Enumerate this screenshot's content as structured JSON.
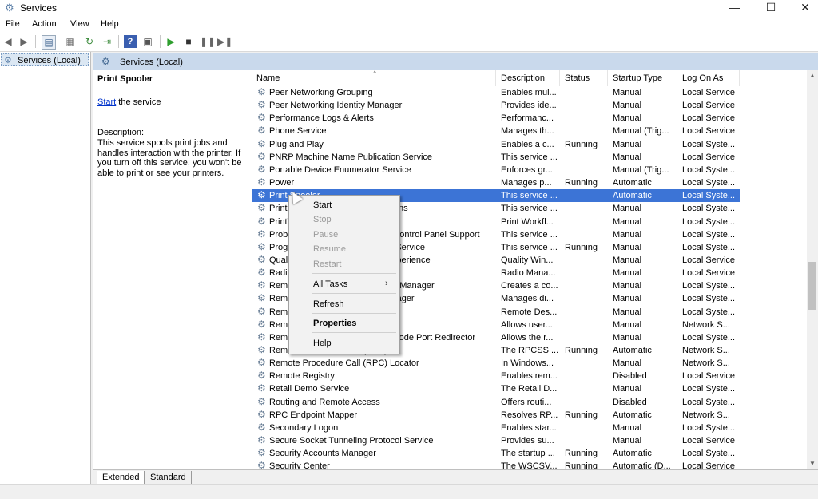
{
  "window": {
    "title": "Services",
    "minimize": "—",
    "maximize": "☐",
    "close": "✕"
  },
  "menu": [
    "File",
    "Action",
    "View",
    "Help"
  ],
  "tree": {
    "root": "Services (Local)"
  },
  "panel": {
    "header": "Services (Local)"
  },
  "details": {
    "service_name": "Print Spooler",
    "start_link": "Start",
    "start_suffix": " the service",
    "description_label": "Description:",
    "description": "This service spools print jobs and handles interaction with the printer. If you turn off this service, you won't be able to print or see your printers."
  },
  "columns": [
    "Name",
    "Description",
    "Status",
    "Startup Type",
    "Log On As"
  ],
  "rows": [
    {
      "name": "Peer Networking Grouping",
      "desc": "Enables mul...",
      "status": "",
      "startup": "Manual",
      "logon": "Local Service"
    },
    {
      "name": "Peer Networking Identity Manager",
      "desc": "Provides ide...",
      "status": "",
      "startup": "Manual",
      "logon": "Local Service"
    },
    {
      "name": "Performance Logs & Alerts",
      "desc": "Performanc...",
      "status": "",
      "startup": "Manual",
      "logon": "Local Service"
    },
    {
      "name": "Phone Service",
      "desc": "Manages th...",
      "status": "",
      "startup": "Manual (Trig...",
      "logon": "Local Service"
    },
    {
      "name": "Plug and Play",
      "desc": "Enables a c...",
      "status": "Running",
      "startup": "Manual",
      "logon": "Local Syste..."
    },
    {
      "name": "PNRP Machine Name Publication Service",
      "desc": "This service ...",
      "status": "",
      "startup": "Manual",
      "logon": "Local Service"
    },
    {
      "name": "Portable Device Enumerator Service",
      "desc": "Enforces gr...",
      "status": "",
      "startup": "Manual (Trig...",
      "logon": "Local Syste..."
    },
    {
      "name": "Power",
      "desc": "Manages p...",
      "status": "Running",
      "startup": "Automatic",
      "logon": "Local Syste..."
    },
    {
      "name": "Print Spooler",
      "desc": "This service ...",
      "status": "",
      "startup": "Automatic",
      "logon": "Local Syste..."
    },
    {
      "name": "Printer Extensions and Notifications",
      "desc": "This service ...",
      "status": "",
      "startup": "Manual",
      "logon": "Local Syste..."
    },
    {
      "name": "PrintWorkflow",
      "desc": "Print Workfl...",
      "status": "",
      "startup": "Manual",
      "logon": "Local Syste..."
    },
    {
      "name": "Problem Reports and Solutions Control Panel Support",
      "desc": "This service ...",
      "status": "",
      "startup": "Manual",
      "logon": "Local Syste..."
    },
    {
      "name": "Program Compatibility Assistant Service",
      "desc": "This service ...",
      "status": "Running",
      "startup": "Manual",
      "logon": "Local Syste..."
    },
    {
      "name": "Quality Windows Audio Video Experience",
      "desc": "Quality Win...",
      "status": "",
      "startup": "Manual",
      "logon": "Local Service"
    },
    {
      "name": "Radio Management Service",
      "desc": "Radio Mana...",
      "status": "",
      "startup": "Manual",
      "logon": "Local Service"
    },
    {
      "name": "Remote Access Auto Connection Manager",
      "desc": "Creates a co...",
      "status": "",
      "startup": "Manual",
      "logon": "Local Syste..."
    },
    {
      "name": "Remote Access Connection Manager",
      "desc": "Manages di...",
      "status": "",
      "startup": "Manual",
      "logon": "Local Syste..."
    },
    {
      "name": "Remote Desktop Configuration",
      "desc": "Remote Des...",
      "status": "",
      "startup": "Manual",
      "logon": "Local Syste..."
    },
    {
      "name": "Remote Desktop Services",
      "desc": "Allows user...",
      "status": "",
      "startup": "Manual",
      "logon": "Network S..."
    },
    {
      "name": "Remote Desktop Services UserMode Port Redirector",
      "desc": "Allows the r...",
      "status": "",
      "startup": "Manual",
      "logon": "Local Syste..."
    },
    {
      "name": "Remote Procedure Call (RPC)",
      "desc": "The RPCSS ...",
      "status": "Running",
      "startup": "Automatic",
      "logon": "Network S..."
    },
    {
      "name": "Remote Procedure Call (RPC) Locator",
      "desc": "In Windows...",
      "status": "",
      "startup": "Manual",
      "logon": "Network S..."
    },
    {
      "name": "Remote Registry",
      "desc": "Enables rem...",
      "status": "",
      "startup": "Disabled",
      "logon": "Local Service"
    },
    {
      "name": "Retail Demo Service",
      "desc": "The Retail D...",
      "status": "",
      "startup": "Manual",
      "logon": "Local Syste..."
    },
    {
      "name": "Routing and Remote Access",
      "desc": "Offers routi...",
      "status": "",
      "startup": "Disabled",
      "logon": "Local Syste..."
    },
    {
      "name": "RPC Endpoint Mapper",
      "desc": "Resolves RP...",
      "status": "Running",
      "startup": "Automatic",
      "logon": "Network S..."
    },
    {
      "name": "Secondary Logon",
      "desc": "Enables star...",
      "status": "",
      "startup": "Manual",
      "logon": "Local Syste..."
    },
    {
      "name": "Secure Socket Tunneling Protocol Service",
      "desc": "Provides su...",
      "status": "",
      "startup": "Manual",
      "logon": "Local Service"
    },
    {
      "name": "Security Accounts Manager",
      "desc": "The startup ...",
      "status": "Running",
      "startup": "Automatic",
      "logon": "Local Syste..."
    },
    {
      "name": "Security Center",
      "desc": "The WSCSV...",
      "status": "Running",
      "startup": "Automatic (D...",
      "logon": "Local Service"
    }
  ],
  "selected_index": 8,
  "context_menu": {
    "start": "Start",
    "stop": "Stop",
    "pause": "Pause",
    "resume": "Resume",
    "restart": "Restart",
    "all_tasks": "All Tasks",
    "refresh": "Refresh",
    "properties": "Properties",
    "help": "Help"
  },
  "tabs": [
    "Extended",
    "Standard"
  ],
  "colors": {
    "selection": "#3c74d6",
    "header": "#c9d9ec",
    "link": "#0033cc"
  }
}
